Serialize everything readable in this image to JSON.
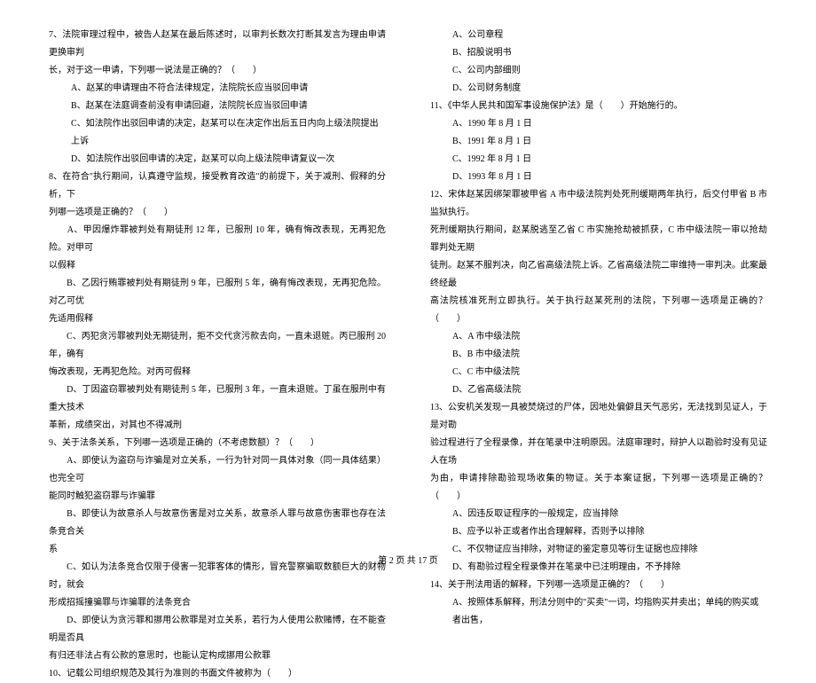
{
  "left_column": {
    "q7": {
      "line1": "7、法院审理过程中，被告人赵某在最后陈述时，以审判长数次打断其发言为理由申请更换审判",
      "line2": "长，对于这一申请，下列哪一说法是正确的？（　　）",
      "optA": "A、赵某的申请理由不符合法律规定，法院院长应当驳回申请",
      "optB": "B、赵某在法庭调查前没有申请回避，法院院长应当驳回申请",
      "optC": "C、如法院作出驳回申请的决定，赵某可以在决定作出后五日内向上级法院提出上诉",
      "optD": "D、如法院作出驳回申请的决定，赵某可以向上级法院申请复议一次"
    },
    "q8": {
      "line1": "8、在符合\"执行期间，认真遵守监规，接受教育改造\"的前提下，关于减刑、假释的分析，下",
      "line2": "列哪一选项是正确的？（　　）",
      "optA1": "　　A、甲因爆炸罪被判处有期徒刑 12 年，已服刑 10 年，确有悔改表现，无再犯危险。对甲可",
      "optA2": "以假释",
      "optB1": "　　B、乙因行贿罪被判处有期徒刑 9 年，已服刑 5 年，确有悔改表现，无再犯危险。对乙可优",
      "optB2": "先适用假释",
      "optC1": "　　C、丙犯贪污罪被判处无期徒刑，拒不交代贪污款去向，一直未退赃。丙已服刑 20 年，确有",
      "optC2": "悔改表现，无再犯危险。对丙可假释",
      "optD1": "　　D、丁因盗窃罪被判处有期徒刑 5 年，已服刑 3 年，一直未退赃。丁虽在服刑中有重大技术",
      "optD2": "革新，成绩突出，对其也不得减刑"
    },
    "q9": {
      "line1": "9、关于法条关系，下列哪一选项是正确的（不考虑数额）？（　　）",
      "optA1": "　　A、即使认为盗窃与诈骗是对立关系，一行为针对同一具体对象（同一具体结果）也完全可",
      "optA2": "能同时触犯盗窃罪与诈骗罪",
      "optB1": "　　B、即使认为故意杀人与故意伤害是对立关系，故意杀人罪与故意伤害罪也存在法条竞合关",
      "optB2": "系",
      "optC1": "　　C、如认为法条竞合仅限于侵害一犯罪客体的情形，冒充警察骗取数额巨大的财物时，就会",
      "optC2": "形成招摇撞骗罪与诈骗罪的法条竞合",
      "optD1": "　　D、即使认为贪污罪和挪用公款罪是对立关系，若行为人使用公款赌博，在不能查明是否具",
      "optD2": "有归还非法占有公款的意思时，也能认定构成挪用公款罪"
    },
    "q10": {
      "line1": "10、记载公司组织规范及其行为准则的书面文件被称为（　　）"
    }
  },
  "right_column": {
    "q10_opts": {
      "optA": "A、公司章程",
      "optB": "B、招股说明书",
      "optC": "C、公司内部细则",
      "optD": "D、公司财务制度"
    },
    "q11": {
      "line1": "11、《中华人民共和国军事设施保护法》是（　　）开始施行的。",
      "optA": "A、1990 年 8 月 1 日",
      "optB": "B、1991 年 8 月 1 日",
      "optC": "C、1992 年 8 月 1 日",
      "optD": "D、1993 年 8 月 1 日"
    },
    "q12": {
      "line1": "12、宋体赵某因绑架罪被甲省 A 市中级法院判处死刑缓期两年执行，后交付甲省 B 市监狱执行。",
      "line2": "死刑缓期执行期间，赵某脱逃至乙省 C 市实施抢劫被抓获，C 市中级法院一审以抢劫罪判处无期",
      "line3": "徒刑。赵某不服判决，向乙省高级法院上诉。乙省高级法院二审维持一审判决。此案最终经最",
      "line4": "高法院核准死刑立即执行。关于执行赵某死刑的法院，下列哪一选项是正确的？（　　）",
      "optA": "A、A 市中级法院",
      "optB": "B、B 市中级法院",
      "optC": "C、C 市中级法院",
      "optD": "D、乙省高级法院"
    },
    "q13": {
      "line1": "13、公安机关发现一具被焚烧过的尸体，因地处偏僻且天气恶劣，无法找到见证人，于是对勘",
      "line2": "验过程进行了全程录像，并在笔录中注明原因。法庭审理时，辩护人以勘验时没有见证人在场",
      "line3": "为由，申请排除勘验现场收集的物证。关于本案证据，下列哪一选项是正确的？（　　）",
      "optA": "A、因违反取证程序的一般规定，应当排除",
      "optB": "B、应予以补正或者作出合理解释，否则予以排除",
      "optC": "C、不仅物证应当排除，对物证的鉴定意见等衍生证据也应排除",
      "optD": "D、有勘验过程全程录像并在笔录中已注明理由，不予排除"
    },
    "q14": {
      "line1": "14、关于刑法用语的解释，下列哪一选项是正确的？（　　）",
      "optA": "A、按照体系解释，刑法分则中的\"买卖\"一词，均指购买并卖出；单纯的购买或者出售，"
    }
  },
  "footer": "第 2 页 共 17 页"
}
